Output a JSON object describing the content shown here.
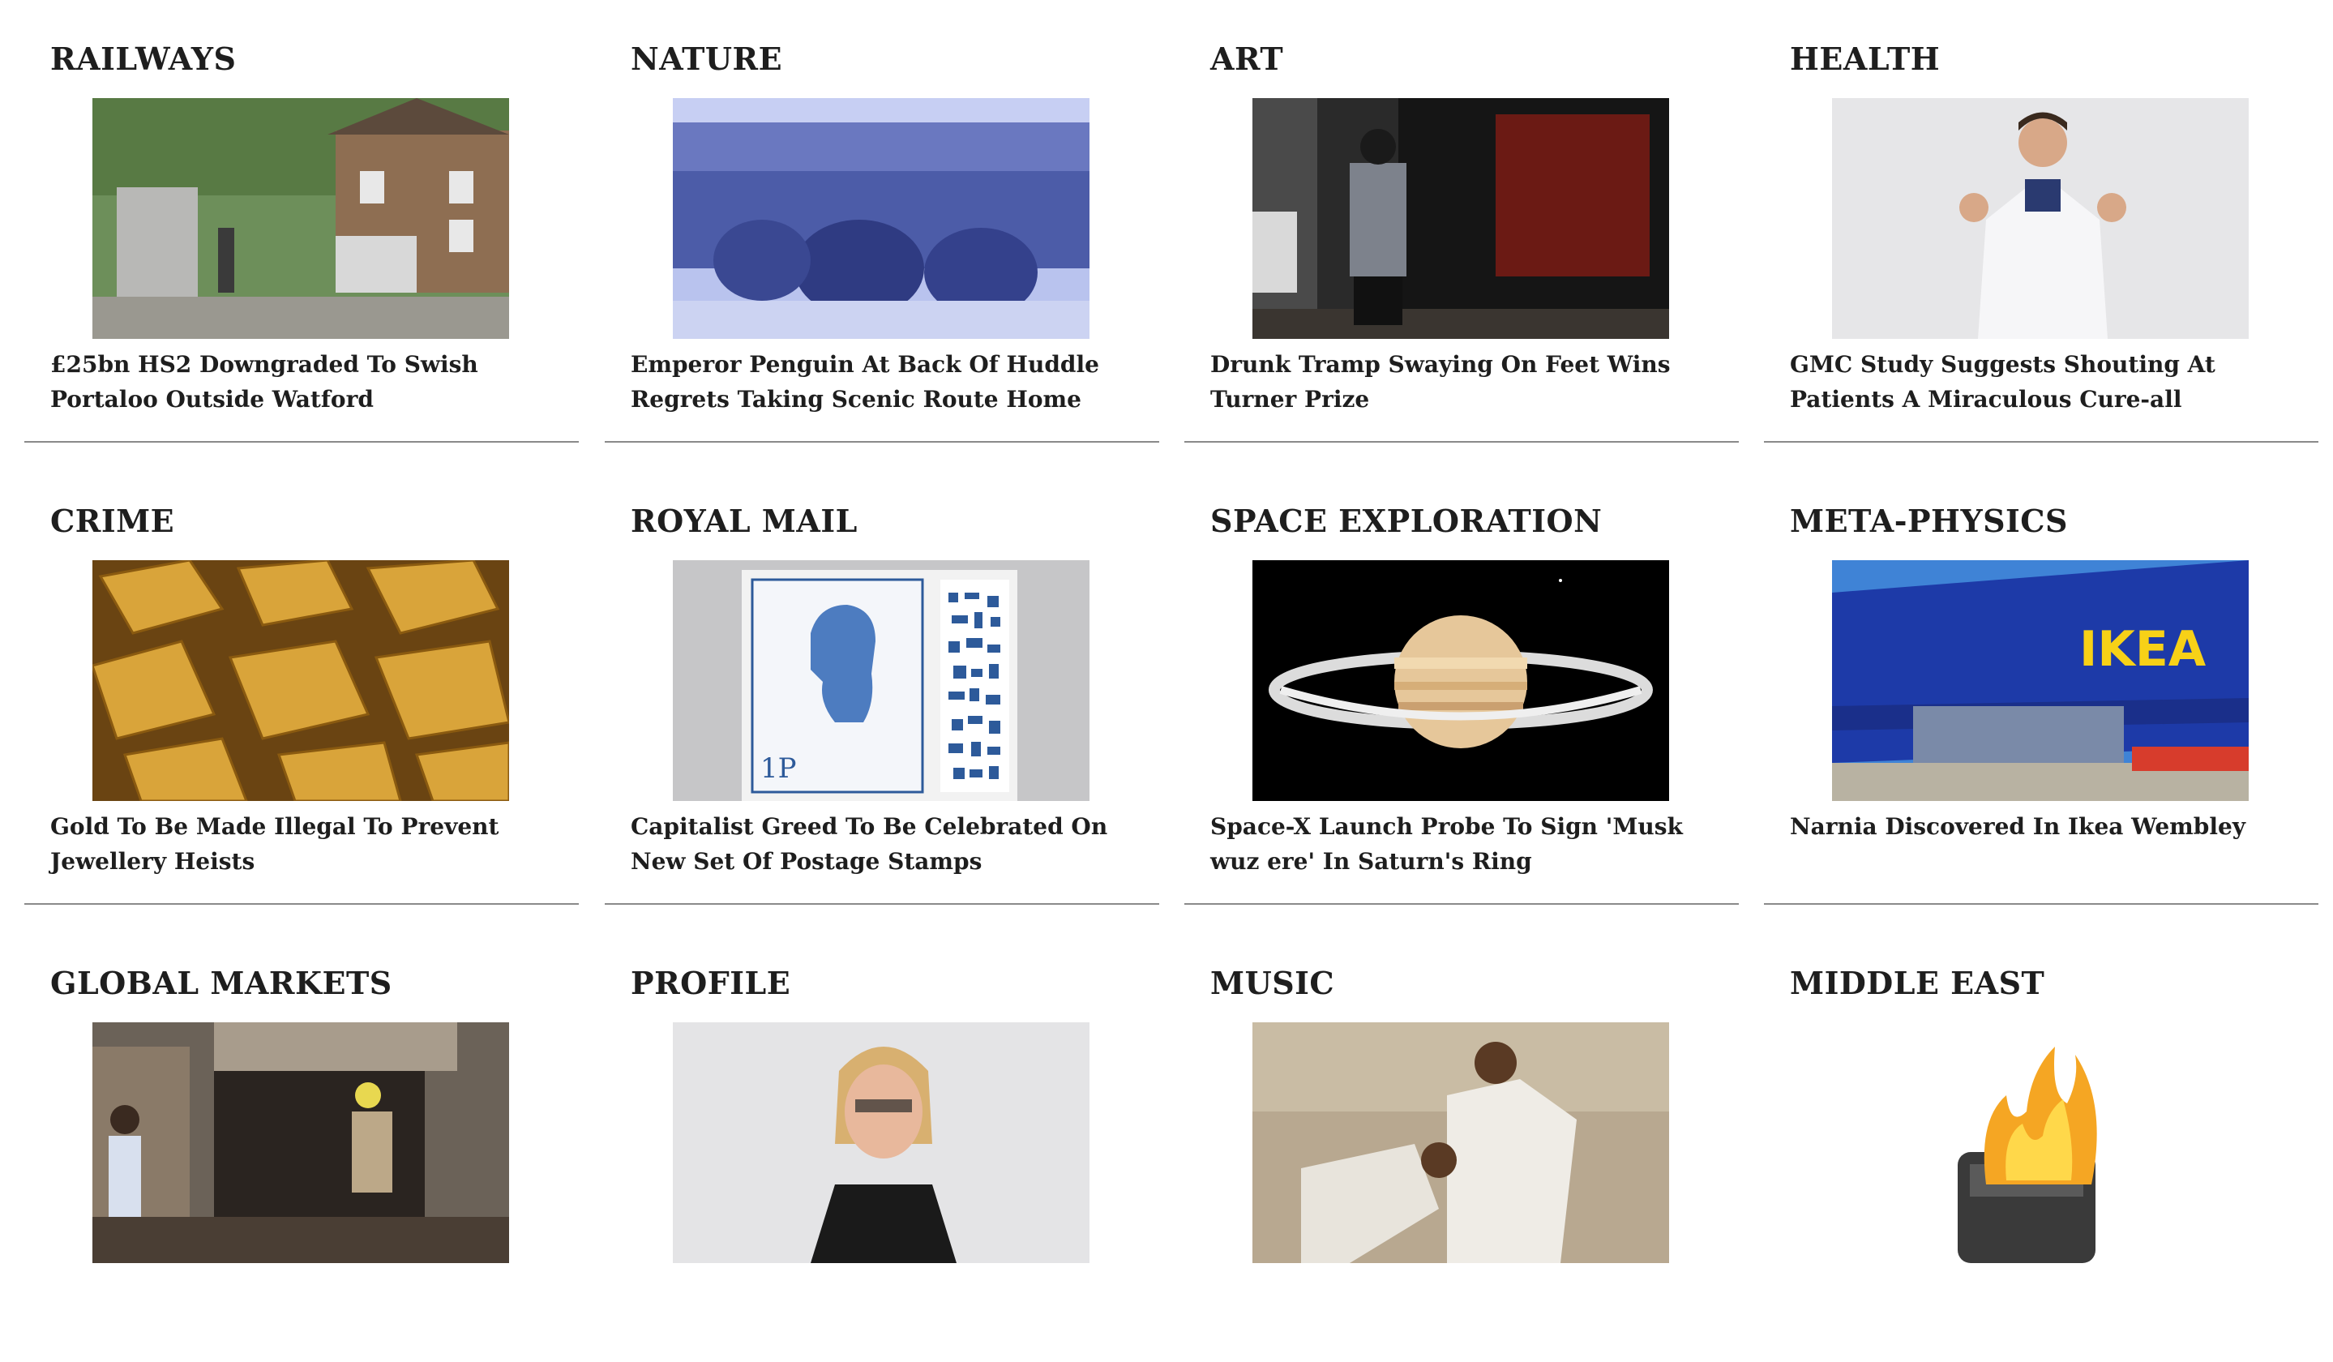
{
  "articles": [
    {
      "category": "RAILWAYS",
      "headline": "£25bn HS2 Downgraded To Swish Portaloo Outside Watford",
      "image": "portaloo-house-photo"
    },
    {
      "category": "NATURE",
      "headline": "Emperor Penguin At Back Of Huddle Regrets Taking Scenic Route Home",
      "image": "penguin-huddle-photo"
    },
    {
      "category": "ART",
      "headline": "Drunk Tramp Swaying On Feet Wins Turner Prize",
      "image": "street-man-gate-photo"
    },
    {
      "category": "HEALTH",
      "headline": "GMC Study Suggests Shouting At Patients A Miraculous Cure-all",
      "image": "shouting-doctor-photo"
    },
    {
      "category": "CRIME",
      "headline": "Gold To Be Made Illegal To Prevent Jewellery Heists",
      "image": "gold-bars-photo"
    },
    {
      "category": "ROYAL MAIL",
      "headline": "Capitalist Greed To Be Celebrated On New Set Of Postage Stamps",
      "image": "postage-stamp-photo",
      "stamp_value": "1P"
    },
    {
      "category": "SPACE EXPLORATION",
      "headline": "Space-X Launch Probe To Sign 'Musk wuz ere' In Saturn's Ring",
      "image": "saturn-photo"
    },
    {
      "category": "META-PHYSICS",
      "headline": "Narnia Discovered In Ikea Wembley",
      "image": "ikea-store-photo",
      "sign_text": "IKEA"
    },
    {
      "category": "GLOBAL MARKETS",
      "headline": "",
      "image": "burnt-shop-photo"
    },
    {
      "category": "PROFILE",
      "headline": "",
      "image": "speaker-woman-photo"
    },
    {
      "category": "MUSIC",
      "headline": "",
      "image": "music-duo-photo"
    },
    {
      "category": "MIDDLE EAST",
      "headline": "",
      "image": "burning-pager-photo"
    }
  ]
}
